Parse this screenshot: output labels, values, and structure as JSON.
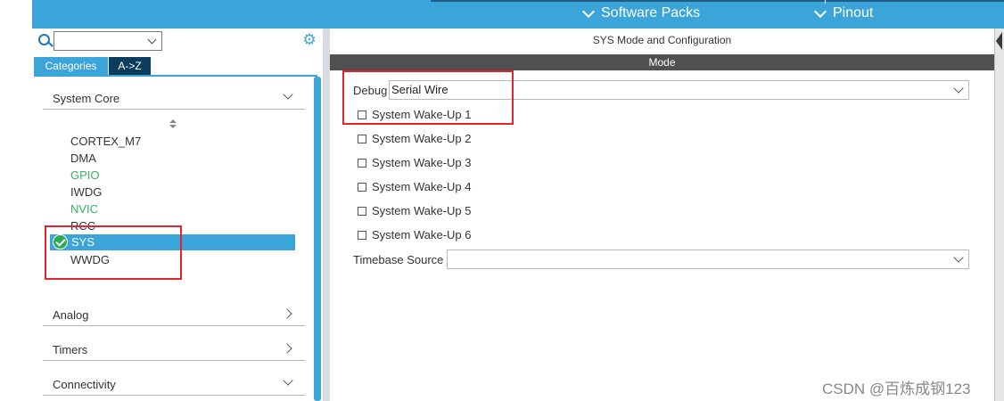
{
  "toolbar": {
    "software_packs_label": "Software Packs",
    "pinout_label": "Pinout"
  },
  "sidebar": {
    "search": {
      "value": "",
      "placeholder": ""
    },
    "tabs": [
      {
        "label": "Categories",
        "active": true
      },
      {
        "label": "A->Z",
        "active": false
      }
    ],
    "categories": [
      {
        "label": "System Core",
        "expanded": true
      },
      {
        "label": "Analog",
        "expanded": false
      },
      {
        "label": "Timers",
        "expanded": false
      },
      {
        "label": "Connectivity",
        "expanded": true
      }
    ],
    "system_core_items": [
      {
        "label": "CORTEX_M7",
        "status": "normal"
      },
      {
        "label": "DMA",
        "status": "normal"
      },
      {
        "label": "GPIO",
        "status": "configured"
      },
      {
        "label": "IWDG",
        "status": "normal"
      },
      {
        "label": "NVIC",
        "status": "configured"
      },
      {
        "label": "RCC",
        "status": "normal"
      },
      {
        "label": "SYS",
        "status": "selected"
      },
      {
        "label": "WWDG",
        "status": "normal"
      }
    ]
  },
  "main": {
    "title": "SYS Mode and Configuration",
    "mode_header": "Mode",
    "debug": {
      "label": "Debug",
      "value": "Serial Wire"
    },
    "wakeups": [
      {
        "label": "System Wake-Up 1",
        "checked": false
      },
      {
        "label": "System Wake-Up 2",
        "checked": false
      },
      {
        "label": "System Wake-Up 3",
        "checked": false
      },
      {
        "label": "System Wake-Up 4",
        "checked": false
      },
      {
        "label": "System Wake-Up 5",
        "checked": false
      },
      {
        "label": "System Wake-Up 6",
        "checked": false
      }
    ],
    "timebase": {
      "label": "Timebase Source",
      "value": ""
    }
  },
  "watermark": "CSDN @百炼成钢123",
  "colors": {
    "accent": "#3ba4d9",
    "configured": "#34b45c",
    "highlight_box": "#e3242b",
    "mode_bar": "#505050"
  }
}
